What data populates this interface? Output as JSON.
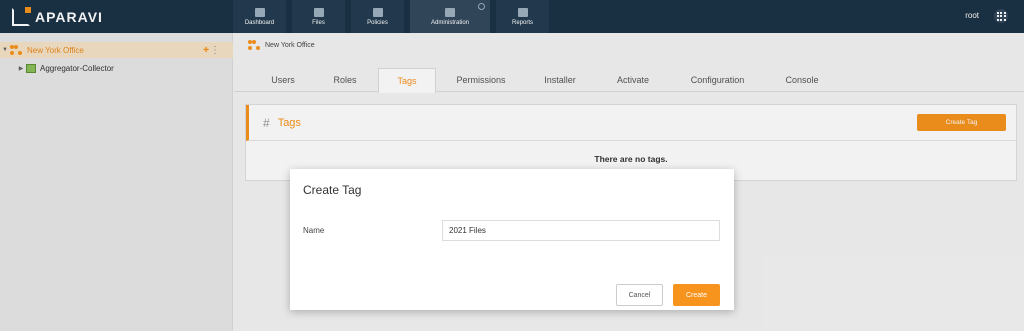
{
  "app": {
    "logo_text": "APARAVI"
  },
  "nav": {
    "items": [
      {
        "label": "Dashboard"
      },
      {
        "label": "Files"
      },
      {
        "label": "Policies"
      },
      {
        "label": "Administration"
      },
      {
        "label": "Reports"
      }
    ],
    "user": "root"
  },
  "sidebar": {
    "items": [
      {
        "label": "New York Office",
        "selected": true
      },
      {
        "label": "Aggregator-Collector"
      }
    ]
  },
  "breadcrumb": {
    "label": "New York Office"
  },
  "tabs": [
    "Users",
    "Roles",
    "Tags",
    "Permissions",
    "Installer",
    "Activate",
    "Configuration",
    "Console"
  ],
  "active_tab": "Tags",
  "panel": {
    "title": "Tags",
    "create_button": "Create Tag",
    "empty_message": "There are no tags."
  },
  "modal": {
    "title": "Create Tag",
    "name_label": "Name",
    "name_value": "2021 Files",
    "cancel_label": "Cancel",
    "create_label": "Create"
  },
  "colors": {
    "accent": "#f7941d",
    "topbar": "#1b3246"
  }
}
